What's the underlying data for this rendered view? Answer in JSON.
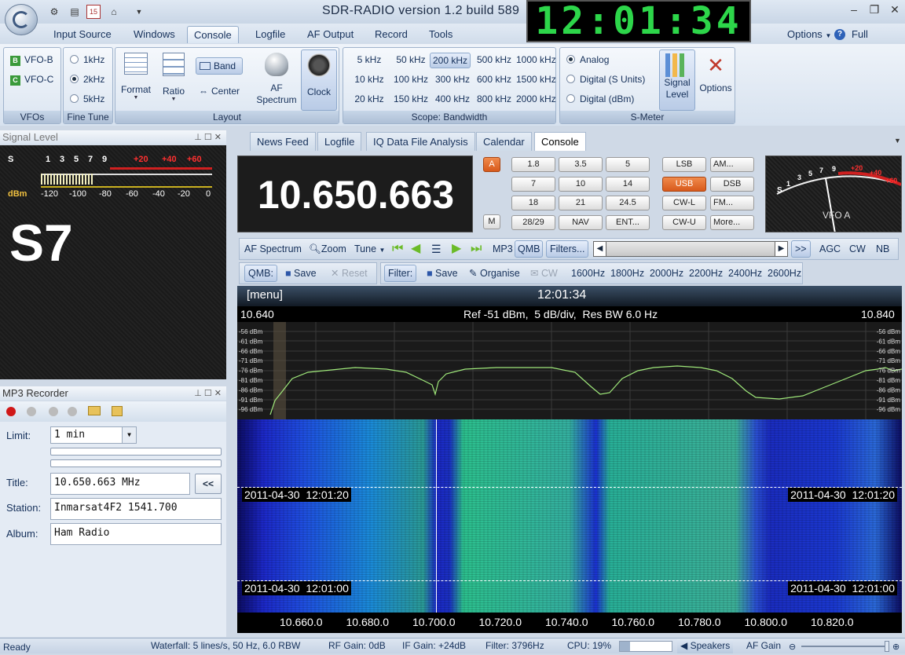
{
  "title": "SDR-RADIO version 1.2  build 589",
  "clock": "12:01:34",
  "menu": [
    "Input Source",
    "Windows",
    "Console",
    "Logfile",
    "AF Output",
    "Record",
    "Tools"
  ],
  "menu_right": {
    "options": "Options",
    "full_screen": "Full Screen"
  },
  "ribbon": {
    "vfos": {
      "items": [
        "VFO-B",
        "VFO-C"
      ],
      "icons": [
        "B",
        "C"
      ],
      "label": "VFOs"
    },
    "fine_tune": {
      "items": [
        "1kHz",
        "2kHz",
        "5kHz"
      ],
      "selected": "2kHz",
      "label": "Fine Tune"
    },
    "layout": {
      "format": "Format",
      "ratio": "Ratio",
      "band": "Band",
      "center": "Center",
      "af_spectrum": "AF Spectrum",
      "clock": "Clock",
      "label": "Layout"
    },
    "bandwidth": {
      "items": [
        "5 kHz",
        "50 kHz",
        "200 kHz",
        "500 kHz",
        "1000 kHz",
        "10 kHz",
        "100 kHz",
        "300 kHz",
        "600 kHz",
        "1500 kHz",
        "20 kHz",
        "150 kHz",
        "400 kHz",
        "800 kHz",
        "2000 kHz"
      ],
      "selected": "200 kHz",
      "label": "Scope: Bandwidth"
    },
    "smeter": {
      "items": [
        "Analog",
        "Digital (S Units)",
        "Digital (dBm)"
      ],
      "selected": "Analog",
      "signal_level": "Signal Level",
      "options": "Options",
      "label": "S-Meter"
    }
  },
  "signal_panel": {
    "title": "Signal Level",
    "s_label": "S",
    "dbm_label": "dBm",
    "s_ticks": [
      "1",
      "3",
      "5",
      "7",
      "9",
      "+20",
      "+40",
      "+60"
    ],
    "dbm_ticks": [
      "-120",
      "-100",
      "-80",
      "-60",
      "-40",
      "-20",
      "0"
    ],
    "reading": "S7"
  },
  "mp3": {
    "title": "MP3 Recorder",
    "limit_label": "Limit:",
    "limit_value": "1 min",
    "title_label": "Title:",
    "title_value": "10.650.663 MHz",
    "copy_btn": "<<",
    "station_label": "Station:",
    "station_value": "Inmarsat4F2 1541.700",
    "album_label": "Album:",
    "album_value": "Ham Radio"
  },
  "doc_tabs": [
    "News Feed",
    "Logfile",
    "IQ Data File Analysis",
    "Calendar",
    "Console"
  ],
  "doc_tab_active": "Console",
  "frequency": "10.650.663",
  "band_buttons": [
    "1.8",
    "3.5",
    "5",
    "7",
    "10",
    "14",
    "18",
    "21",
    "24.5",
    "28/29",
    "NAV",
    "ENT..."
  ],
  "ab_buttons": {
    "a": "A",
    "m": "M"
  },
  "mode_buttons": [
    "LSB",
    "AM...",
    "USB",
    "DSB",
    "CW-L",
    "FM...",
    "CW-U",
    "More..."
  ],
  "mode_active": "USB",
  "meter": {
    "ticks": [
      "1",
      "3",
      "5",
      "7",
      "9",
      "+20",
      "+40",
      "+60"
    ],
    "s_label": "S",
    "vfo": "VFO A"
  },
  "toolbar1": {
    "af_spectrum": "AF Spectrum",
    "zoom": "Zoom",
    "tune": "Tune",
    "mp3": "MP3",
    "qmb": "QMB",
    "filters": "Filters...",
    "more": ">>",
    "agc": "AGC",
    "cw": "CW",
    "nb": "NB"
  },
  "toolbar2": {
    "qmb": "QMB:",
    "save": "Save",
    "reset": "Reset",
    "filter": "Filter:",
    "save2": "Save",
    "organise": "Organise",
    "cw": "CW",
    "filters": [
      "1600Hz",
      "1800Hz",
      "2000Hz",
      "2200Hz",
      "2400Hz",
      "2600Hz"
    ]
  },
  "spectrum": {
    "menu": "[menu]",
    "time": "12:01:34",
    "f_low": "10.640",
    "f_high": "10.840",
    "ref": "Ref -51 dBm,  5 dB/div,  Res BW 6.0 Hz",
    "db_labels": [
      "-56 dBm",
      "-61 dBm",
      "-66 dBm",
      "-71 dBm",
      "-76 dBm",
      "-81 dBm",
      "-86 dBm",
      "-91 dBm",
      "-96 dBm"
    ],
    "wf_stamp1": "2011-04-30  12:01:20",
    "wf_stamp2": "2011-04-30  12:01:00",
    "x_ticks": [
      "10.660.0",
      "10.680.0",
      "10.700.0",
      "10.720.0",
      "10.740.0",
      "10.760.0",
      "10.780.0",
      "10.800.0",
      "10.820.0"
    ]
  },
  "status": {
    "ready": "Ready",
    "waterfall": "Waterfall: 5 lines/s, 50 Hz, 6.0 RBW",
    "rf_gain": "RF Gain: 0dB",
    "if_gain": "IF Gain: +24dB",
    "filter": "Filter: 3796Hz",
    "cpu": "CPU: 19%",
    "speakers": "Speakers",
    "af_gain": "AF Gain"
  }
}
